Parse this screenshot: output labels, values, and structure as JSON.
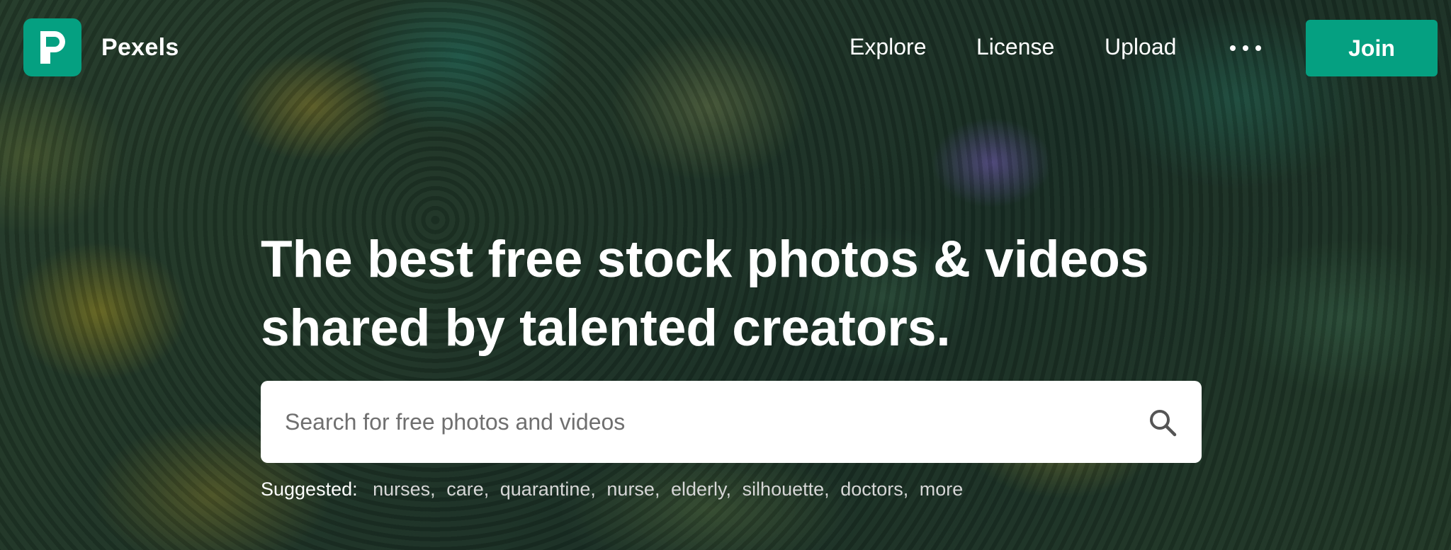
{
  "header": {
    "brand": "Pexels",
    "nav": [
      "Explore",
      "License",
      "Upload"
    ],
    "more_icon": "more-dots-icon",
    "join_label": "Join"
  },
  "hero": {
    "headline_line1": "The best free stock photos & videos",
    "headline_line2": "shared by talented creators."
  },
  "search": {
    "placeholder": "Search for free photos and videos",
    "value": "",
    "icon": "search-icon"
  },
  "suggested": {
    "label": "Suggested:",
    "items": [
      "nurses",
      "care",
      "quarantine",
      "nurse",
      "elderly",
      "silhouette",
      "doctors",
      "more"
    ]
  },
  "colors": {
    "brand": "#05a081",
    "text": "#ffffff"
  }
}
